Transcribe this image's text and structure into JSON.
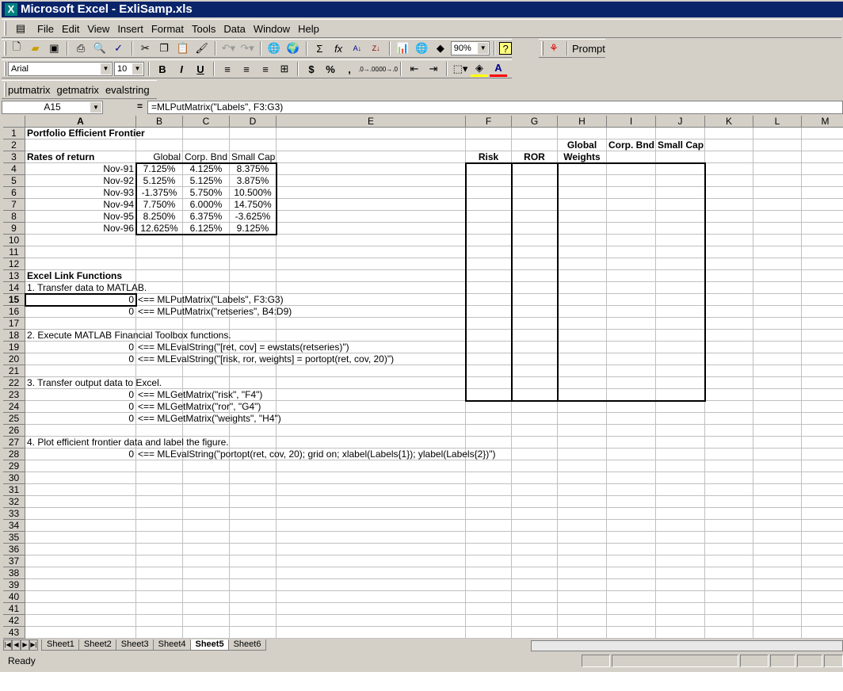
{
  "window": {
    "title": "Microsoft Excel - ExliSamp.xls",
    "app_icon": "excel-x-icon"
  },
  "menu": [
    "File",
    "Edit",
    "View",
    "Insert",
    "Format",
    "Tools",
    "Data",
    "Window",
    "Help"
  ],
  "toolbar": {
    "zoom": "90%",
    "font": "Arial",
    "size": "10",
    "prompt_label": "Prompt"
  },
  "custom_toolbar": {
    "putmatrix": "putmatrix",
    "getmatrix": "getmatrix",
    "evalstring": "evalstring"
  },
  "formula_bar": {
    "name_box": "A15",
    "equals": "=",
    "formula": "=MLPutMatrix(\"Labels\", F3:G3)"
  },
  "columns": [
    "A",
    "B",
    "C",
    "D",
    "E",
    "F",
    "G",
    "H",
    "I",
    "J",
    "K",
    "L",
    "M"
  ],
  "cells": [
    {
      "ref": "A1",
      "v": "Portfolio Efficient Frontier",
      "b": true
    },
    {
      "ref": "H2",
      "v": "Global",
      "b": true,
      "al": "center"
    },
    {
      "ref": "I2",
      "v": "Corp. Bnd",
      "b": true,
      "al": "center"
    },
    {
      "ref": "J2",
      "v": "Small Cap",
      "b": true,
      "al": "center"
    },
    {
      "ref": "A3",
      "v": "Rates of return",
      "b": true
    },
    {
      "ref": "B3",
      "v": "Global",
      "al": "right"
    },
    {
      "ref": "C3",
      "v": "Corp. Bnd",
      "al": "right"
    },
    {
      "ref": "D3",
      "v": "Small Cap",
      "al": "right"
    },
    {
      "ref": "F3",
      "v": "Risk",
      "b": true,
      "al": "center"
    },
    {
      "ref": "G3",
      "v": "ROR",
      "b": true,
      "al": "center"
    },
    {
      "ref": "H3",
      "v": "Weights",
      "b": true,
      "al": "center"
    },
    {
      "ref": "A4",
      "v": "Nov-91",
      "al": "right"
    },
    {
      "ref": "B4",
      "v": "7.125%",
      "al": "center"
    },
    {
      "ref": "C4",
      "v": "4.125%",
      "al": "center"
    },
    {
      "ref": "D4",
      "v": "8.375%",
      "al": "center"
    },
    {
      "ref": "A5",
      "v": "Nov-92",
      "al": "right"
    },
    {
      "ref": "B5",
      "v": "5.125%",
      "al": "center"
    },
    {
      "ref": "C5",
      "v": "5.125%",
      "al": "center"
    },
    {
      "ref": "D5",
      "v": "3.875%",
      "al": "center"
    },
    {
      "ref": "A6",
      "v": "Nov-93",
      "al": "right"
    },
    {
      "ref": "B6",
      "v": "-1.375%",
      "al": "center"
    },
    {
      "ref": "C6",
      "v": "5.750%",
      "al": "center"
    },
    {
      "ref": "D6",
      "v": "10.500%",
      "al": "center"
    },
    {
      "ref": "A7",
      "v": "Nov-94",
      "al": "right"
    },
    {
      "ref": "B7",
      "v": "7.750%",
      "al": "center"
    },
    {
      "ref": "C7",
      "v": "6.000%",
      "al": "center"
    },
    {
      "ref": "D7",
      "v": "14.750%",
      "al": "center"
    },
    {
      "ref": "A8",
      "v": "Nov-95",
      "al": "right"
    },
    {
      "ref": "B8",
      "v": "8.250%",
      "al": "center"
    },
    {
      "ref": "C8",
      "v": "6.375%",
      "al": "center"
    },
    {
      "ref": "D8",
      "v": "-3.625%",
      "al": "center"
    },
    {
      "ref": "A9",
      "v": "Nov-96",
      "al": "right"
    },
    {
      "ref": "B9",
      "v": "12.625%",
      "al": "center"
    },
    {
      "ref": "C9",
      "v": "6.125%",
      "al": "center"
    },
    {
      "ref": "D9",
      "v": "9.125%",
      "al": "center"
    },
    {
      "ref": "A13",
      "v": "Excel Link Functions",
      "b": true
    },
    {
      "ref": "A14",
      "v": "1.  Transfer data to MATLAB."
    },
    {
      "ref": "A15",
      "v": "0",
      "al": "right"
    },
    {
      "ref": "B15",
      "v": "<== MLPutMatrix(\"Labels\", F3:G3)"
    },
    {
      "ref": "A16",
      "v": "0",
      "al": "right"
    },
    {
      "ref": "B16",
      "v": "<== MLPutMatrix(\"retseries\", B4:D9)"
    },
    {
      "ref": "A18",
      "v": "2.  Execute MATLAB Financial Toolbox functions."
    },
    {
      "ref": "A19",
      "v": "0",
      "al": "right"
    },
    {
      "ref": "B19",
      "v": "<== MLEvalString(\"[ret, cov] = ewstats(retseries)\")"
    },
    {
      "ref": "A20",
      "v": "0",
      "al": "right"
    },
    {
      "ref": "B20",
      "v": "<== MLEvalString(\"[risk, ror, weights] = portopt(ret, cov, 20)\")"
    },
    {
      "ref": "A22",
      "v": "3.  Transfer output data to Excel."
    },
    {
      "ref": "A23",
      "v": "0",
      "al": "right"
    },
    {
      "ref": "B23",
      "v": "<== MLGetMatrix(\"risk\", \"F4\")"
    },
    {
      "ref": "A24",
      "v": "0",
      "al": "right"
    },
    {
      "ref": "B24",
      "v": "<== MLGetMatrix(\"ror\", \"G4\")"
    },
    {
      "ref": "A25",
      "v": "0",
      "al": "right"
    },
    {
      "ref": "B25",
      "v": "<== MLGetMatrix(\"weights\", \"H4\")"
    },
    {
      "ref": "A27",
      "v": "4.  Plot efficient frontier data and label the figure."
    },
    {
      "ref": "A28",
      "v": "0",
      "al": "right"
    },
    {
      "ref": "B28",
      "v": "<== MLEvalString(\"portopt(ret, cov, 20); grid on; xlabel(Labels{1}); ylabel(Labels{2})\")"
    }
  ],
  "sheets": [
    "Sheet1",
    "Sheet2",
    "Sheet3",
    "Sheet4",
    "Sheet5",
    "Sheet6"
  ],
  "active_sheet": "Sheet5",
  "status": "Ready"
}
